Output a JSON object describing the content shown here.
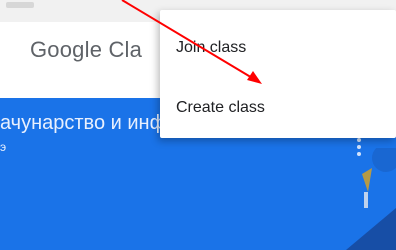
{
  "app": {
    "title": "Google Cla"
  },
  "menu": {
    "items": [
      {
        "label": "Join class"
      },
      {
        "label": "Create class"
      }
    ]
  },
  "class_card": {
    "title": "ачунарство и информа...",
    "subtitle": "э"
  },
  "colors": {
    "card_blue": "#1a73e8",
    "annotation_arrow": "#ff0000",
    "title_grey": "#5f6368"
  },
  "icons": {
    "card_menu": "more-vert-icon",
    "annotation": "arrow-annotation"
  }
}
